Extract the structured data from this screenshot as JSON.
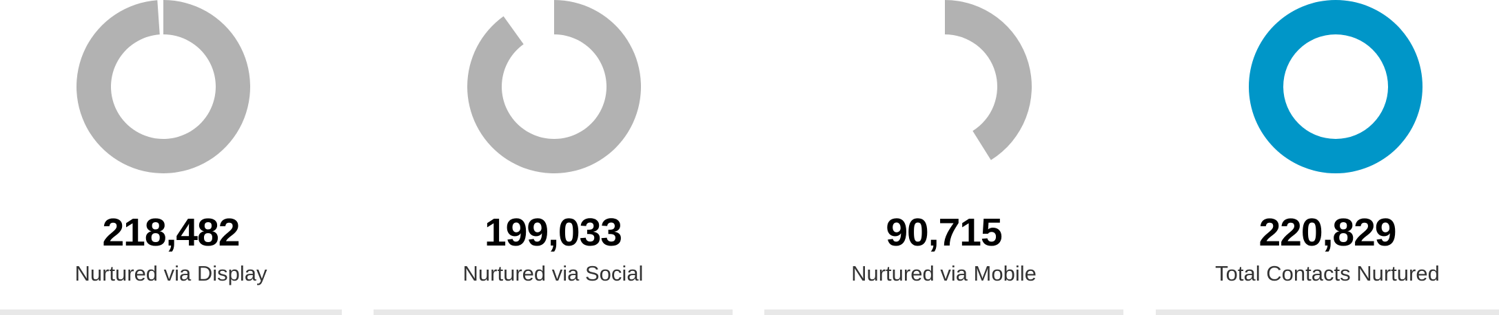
{
  "stats": [
    {
      "value": "218,482",
      "label": "Nurtured via Display",
      "fraction": 0.989,
      "color": "#b2b2b2"
    },
    {
      "value": "199,033",
      "label": "Nurtured via Social",
      "fraction": 0.901,
      "color": "#b2b2b2"
    },
    {
      "value": "90,715",
      "label": "Nurtured via Mobile",
      "fraction": 0.411,
      "color": "#b2b2b2"
    },
    {
      "value": "220,829",
      "label": "Total Contacts Nurtured",
      "fraction": 1.0,
      "color": "#0096c8"
    }
  ]
}
